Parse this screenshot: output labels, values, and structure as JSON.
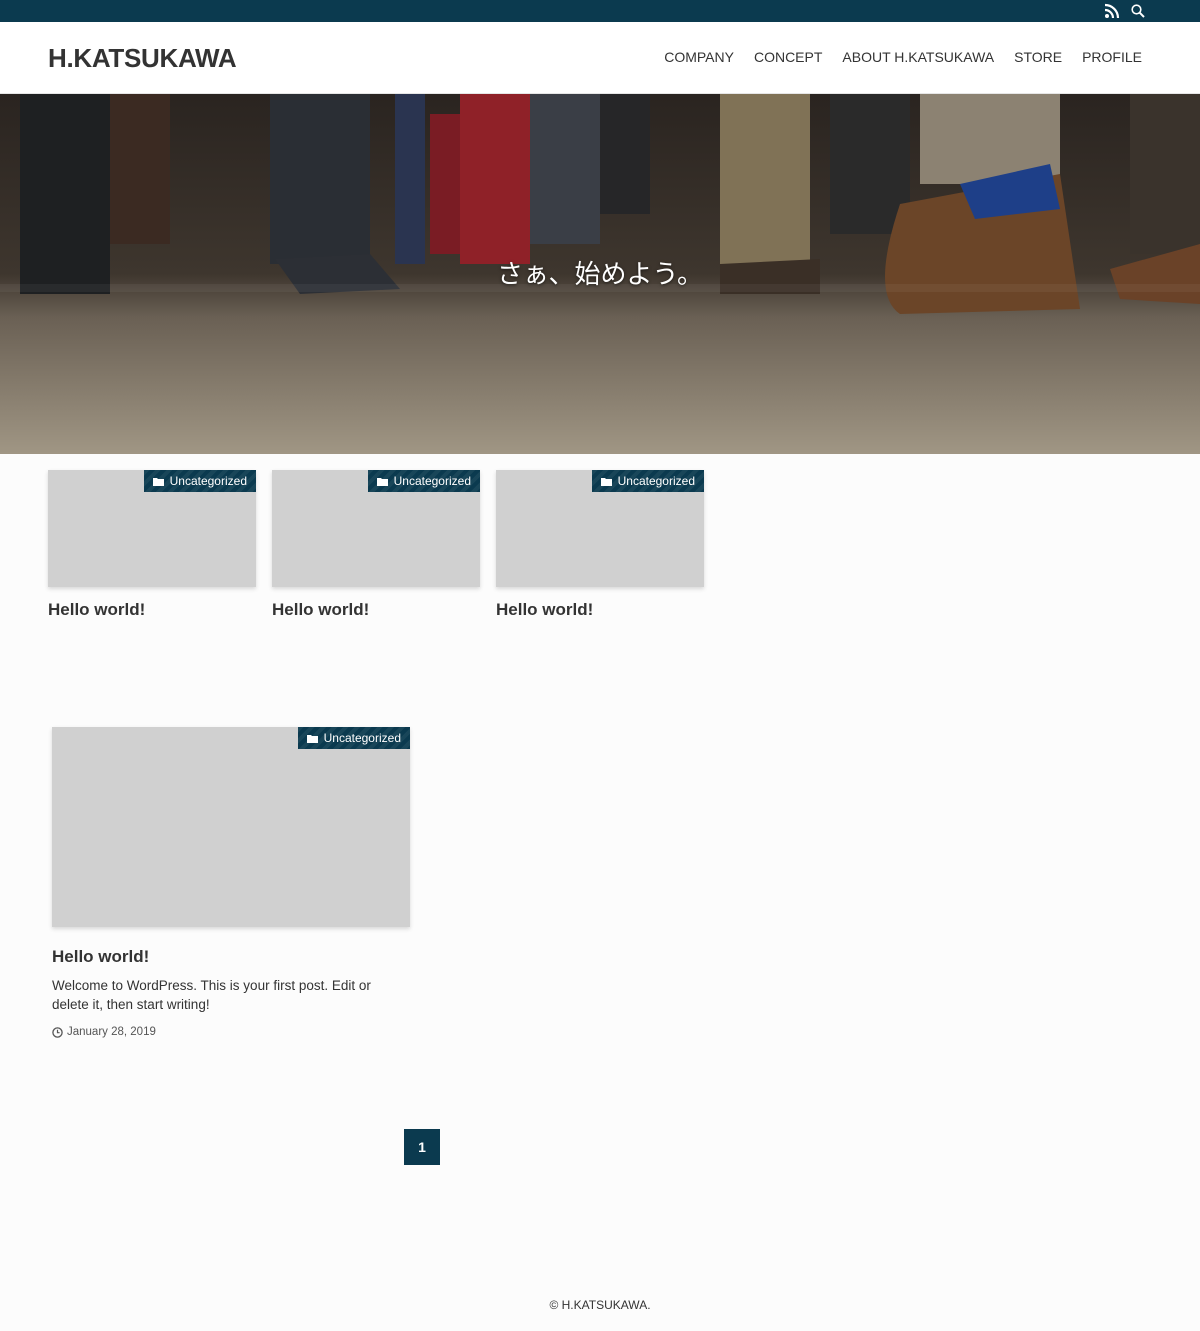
{
  "topbar": {
    "icons": [
      "rss-icon",
      "search-icon"
    ]
  },
  "header": {
    "site_title": "H.KATSUKAWA",
    "nav": [
      "COMPANY",
      "CONCEPT",
      "ABOUT H.KATSUKAWA",
      "STORE",
      "PROFILE"
    ]
  },
  "hero": {
    "tagline": "さぁ、始めよう。"
  },
  "posts_top": [
    {
      "category": "Uncategorized",
      "title": "Hello world!"
    },
    {
      "category": "Uncategorized",
      "title": "Hello world!"
    },
    {
      "category": "Uncategorized",
      "title": "Hello world!"
    }
  ],
  "post_featured": {
    "category": "Uncategorized",
    "title": "Hello world!",
    "excerpt": "Welcome to WordPress. This is your first post. Edit or delete it, then start writing!",
    "date": "January 28, 2019"
  },
  "pagination": {
    "current": "1"
  },
  "footer": {
    "copyright": "© H.KATSUKAWA."
  },
  "colors": {
    "accent": "#0b3a4f",
    "thumb_placeholder": "#d0d0d0"
  }
}
